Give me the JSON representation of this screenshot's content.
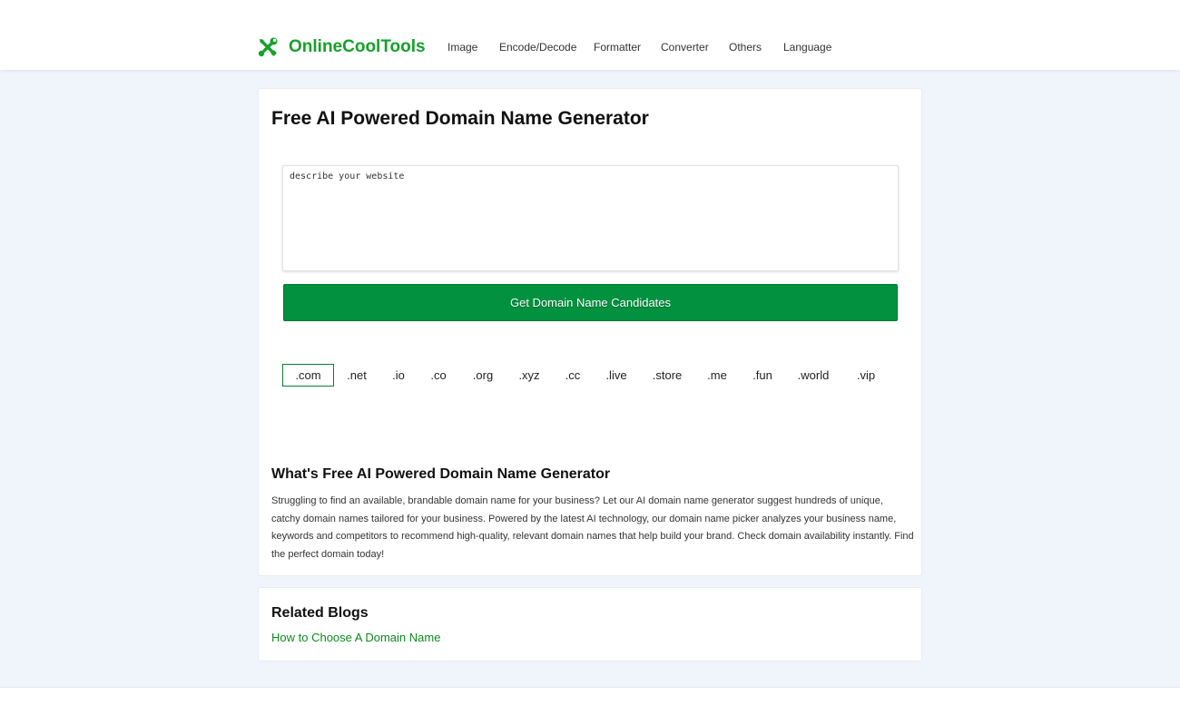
{
  "brand": {
    "name": "OnlineCoolTools",
    "color": "#17a02b",
    "icon": "tools-icon"
  },
  "nav": {
    "image": "Image",
    "encode_decode": "Encode/Decode",
    "formatter": "Formatter",
    "converter": "Converter",
    "others": "Others",
    "language": "Language"
  },
  "main": {
    "title": "Free AI Powered Domain Name Generator",
    "input_placeholder": "describe your website",
    "input_value": "",
    "button_label": "Get Domain Name Candidates",
    "button_color": "#02913f",
    "tlds": [
      ".com",
      ".net",
      ".io",
      ".co",
      ".org",
      ".xyz",
      ".cc",
      ".live",
      ".store",
      ".me",
      ".fun",
      ".world",
      ".vip"
    ],
    "selected_tld": ".com"
  },
  "about": {
    "title": "What's Free AI Powered Domain Name Generator",
    "text": "Struggling to find an available, brandable domain name for your business? Let our AI domain name generator suggest hundreds of unique, catchy domain names tailored for your business. Powered by the latest AI technology, our domain name picker analyzes your business name, keywords and competitors to recommend high-quality, relevant domain names that help build your brand. Check domain availability instantly. Find the perfect domain today!"
  },
  "blogs": {
    "title": "Related Blogs",
    "links": [
      "How to Choose A Domain Name"
    ]
  },
  "colors": {
    "page_background": "#f0f4fb",
    "link": "#0b8a1e",
    "tld_selected_border": "#0b7d36"
  }
}
